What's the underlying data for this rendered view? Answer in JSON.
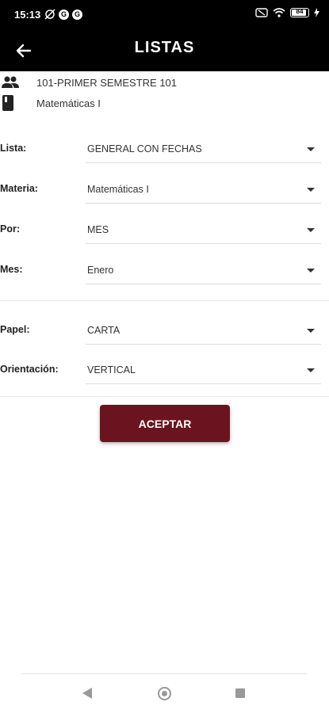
{
  "status": {
    "time": "15:13",
    "battery": "84"
  },
  "appbar": {
    "title": "LISTAS"
  },
  "info": {
    "group": "101-PRIMER SEMESTRE 101",
    "subject": "Matemáticas I"
  },
  "form": {
    "lista": {
      "label": "Lista:",
      "value": "GENERAL CON FECHAS"
    },
    "materia": {
      "label": "Materia:",
      "value": "Matemáticas I"
    },
    "por": {
      "label": "Por:",
      "value": "MES"
    },
    "mes": {
      "label": "Mes:",
      "value": "Enero"
    },
    "papel": {
      "label": "Papel:",
      "value": "CARTA"
    },
    "orientacion": {
      "label": "Orientación:",
      "value": "VERTICAL"
    }
  },
  "actions": {
    "accept_label": "ACEPTAR"
  },
  "colors": {
    "appbar": "#000000",
    "accent": "#6b1420"
  },
  "icons": [
    "back-arrow-icon",
    "group-icon",
    "book-icon",
    "dropdown-caret-icon"
  ]
}
